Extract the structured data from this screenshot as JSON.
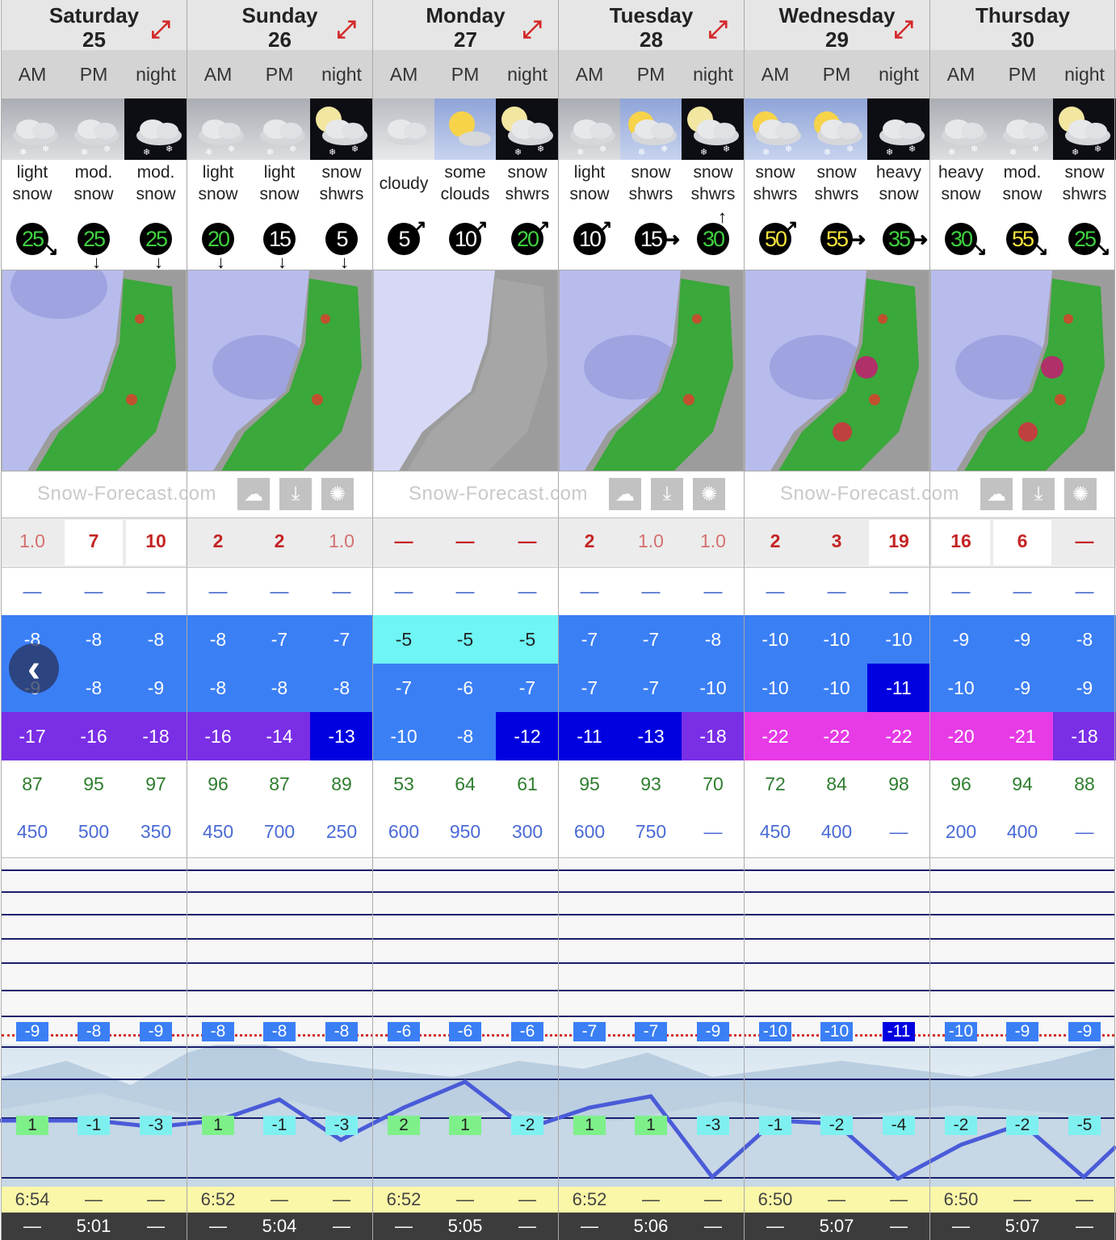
{
  "days": [
    {
      "name": "Saturday",
      "num": "25"
    },
    {
      "name": "Sunday",
      "num": "26"
    },
    {
      "name": "Monday",
      "num": "27"
    },
    {
      "name": "Tuesday",
      "num": "28"
    },
    {
      "name": "Wednesday",
      "num": "29"
    },
    {
      "name": "Thursday",
      "num": "30"
    }
  ],
  "expand_icon": "expand-arrows-icon",
  "periods": [
    "AM",
    "PM",
    "night",
    "AM",
    "PM",
    "night",
    "AM",
    "PM",
    "night",
    "AM",
    "PM",
    "night",
    "AM",
    "PM",
    "night",
    "AM",
    "PM",
    "night"
  ],
  "summaries": [
    [
      "light",
      "snow"
    ],
    [
      "mod.",
      "snow"
    ],
    [
      "mod.",
      "snow"
    ],
    [
      "light",
      "snow"
    ],
    [
      "light",
      "snow"
    ],
    [
      "snow",
      "shwrs"
    ],
    [
      "cloudy",
      ""
    ],
    [
      "some",
      "clouds"
    ],
    [
      "snow",
      "shwrs"
    ],
    [
      "light",
      "snow"
    ],
    [
      "snow",
      "shwrs"
    ],
    [
      "snow",
      "shwrs"
    ],
    [
      "snow",
      "shwrs"
    ],
    [
      "snow",
      "shwrs"
    ],
    [
      "heavy",
      "snow"
    ],
    [
      "heavy",
      "snow"
    ],
    [
      "mod.",
      "snow"
    ],
    [
      "snow",
      "shwrs"
    ]
  ],
  "wind": [
    "25",
    "25",
    "25",
    "20",
    "15",
    "5",
    "5",
    "10",
    "20",
    "10",
    "15",
    "30",
    "50",
    "55",
    "35",
    "30",
    "55",
    "25"
  ],
  "wind_colors": [
    "#3fd13f",
    "#3fd13f",
    "#3fd13f",
    "#3fd13f",
    "#ffffff",
    "#ffffff",
    "#ffffff",
    "#ffffff",
    "#3fd13f",
    "#ffffff",
    "#ffffff",
    "#3fd13f",
    "#f5e23a",
    "#f5e23a",
    "#3fd13f",
    "#3fd13f",
    "#f5e23a",
    "#3fd13f"
  ],
  "map_logo": "Snow-Forecast.com",
  "map_icons": [
    "cloud-icon",
    "download-icon",
    "sun-icon"
  ],
  "snow": [
    "1.0",
    "7",
    "10",
    "2",
    "2",
    "1.0",
    "—",
    "—",
    "—",
    "2",
    "1.0",
    "1.0",
    "2",
    "3",
    "19",
    "16",
    "6",
    "—"
  ],
  "rain": [
    "—",
    "—",
    "—",
    "—",
    "—",
    "—",
    "—",
    "—",
    "—",
    "—",
    "—",
    "—",
    "—",
    "—",
    "—",
    "—",
    "—",
    "—"
  ],
  "temp_max": [
    "-8",
    "-8",
    "-8",
    "-8",
    "-7",
    "-7",
    "-5",
    "-5",
    "-5",
    "-7",
    "-7",
    "-8",
    "-10",
    "-10",
    "-10",
    "-9",
    "-9",
    "-8"
  ],
  "temp_min": [
    "-9",
    "-8",
    "-9",
    "-8",
    "-8",
    "-8",
    "-7",
    "-6",
    "-7",
    "-7",
    "-7",
    "-10",
    "-10",
    "-10",
    "-11",
    "-10",
    "-9",
    "-9"
  ],
  "wind_chill": [
    "-17",
    "-16",
    "-18",
    "-16",
    "-14",
    "-13",
    "-10",
    "-8",
    "-12",
    "-11",
    "-13",
    "-18",
    "-22",
    "-22",
    "-22",
    "-20",
    "-21",
    "-18"
  ],
  "humidity": [
    "87",
    "95",
    "97",
    "96",
    "87",
    "89",
    "53",
    "64",
    "61",
    "95",
    "93",
    "70",
    "72",
    "84",
    "98",
    "96",
    "94",
    "88"
  ],
  "freezing_level": [
    "450",
    "500",
    "350",
    "450",
    "700",
    "250",
    "600",
    "950",
    "300",
    "600",
    "750",
    "—",
    "450",
    "400",
    "—",
    "200",
    "400",
    "—"
  ],
  "top_temps": [
    "-9",
    "-8",
    "-9",
    "-8",
    "-8",
    "-8",
    "-6",
    "-6",
    "-6",
    "-7",
    "-7",
    "-9",
    "-10",
    "-10",
    "-11",
    "-10",
    "-9",
    "-9"
  ],
  "base_temps": [
    "1",
    "-1",
    "-3",
    "1",
    "-1",
    "-3",
    "2",
    "1",
    "-2",
    "1",
    "1",
    "-3",
    "-1",
    "-2",
    "-4",
    "-2",
    "-2",
    "-5"
  ],
  "sunrise": [
    "6:54",
    "—",
    "—",
    "6:52",
    "—",
    "—",
    "6:52",
    "—",
    "—",
    "6:52",
    "—",
    "—",
    "6:50",
    "—",
    "—",
    "6:50",
    "—",
    "—"
  ],
  "sunset": [
    "—",
    "5:01",
    "—",
    "—",
    "5:04",
    "—",
    "—",
    "5:05",
    "—",
    "—",
    "5:06",
    "—",
    "—",
    "5:07",
    "—",
    "—",
    "5:07",
    "—"
  ],
  "nav": {
    "prev_icon": "chevron-left-icon"
  }
}
